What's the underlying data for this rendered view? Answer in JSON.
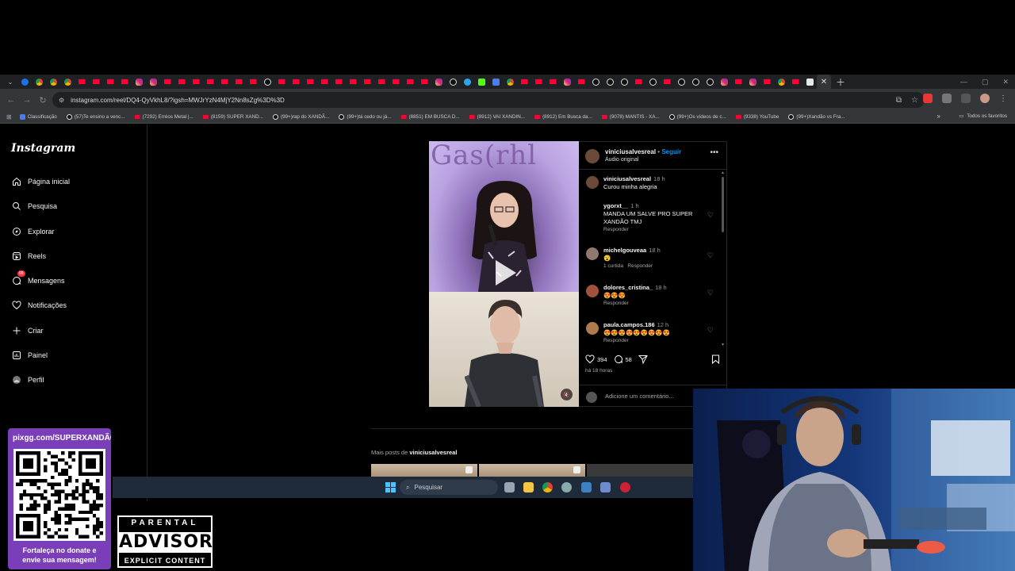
{
  "browser": {
    "url": "instagram.com/reel/DQ4-QyVkhL8/?igsh=MWJrYzN4MjY2Nn8sZg%3D%3D",
    "tab_favicons": [
      "gr",
      "cr",
      "cr",
      "cr",
      "yt",
      "yt",
      "yt",
      "yt",
      "ig",
      "ig",
      "yt",
      "yt",
      "yt",
      "yt",
      "yt",
      "yt",
      "yt",
      "tt",
      "yt",
      "yt",
      "yt",
      "yt",
      "yt",
      "yt",
      "yt",
      "yt",
      "yt",
      "yt",
      "yt",
      "ig",
      "tt",
      "tg",
      "kk",
      "bl",
      "cr",
      "yt",
      "yt",
      "yt",
      "ig",
      "yt",
      "tt",
      "tt",
      "tt",
      "yt",
      "tt",
      "yt",
      "tt",
      "tt",
      "tt",
      "ig",
      "yt",
      "ig",
      "yt",
      "cr",
      "yt",
      "wh"
    ],
    "bookmarks": [
      {
        "icon": "bl",
        "label": "Classificação"
      },
      {
        "icon": "tt",
        "label": "(57)Te ensino a venc..."
      },
      {
        "icon": "yt",
        "label": "(7292) Erréos Metal |..."
      },
      {
        "icon": "yt",
        "label": "(8159) SUPER XAND..."
      },
      {
        "icon": "tt",
        "label": "(99+)rap do XANDÃ..."
      },
      {
        "icon": "tt",
        "label": "(99+)tá cedo ou já..."
      },
      {
        "icon": "yt",
        "label": "(8851) EM BUSCA D..."
      },
      {
        "icon": "yt",
        "label": "(8912) VAI XANDIN..."
      },
      {
        "icon": "yt",
        "label": "(8912) Em Busca da..."
      },
      {
        "icon": "yt",
        "label": "(9078) MANTIS - XA..."
      },
      {
        "icon": "tt",
        "label": "(99+)Os vídeos de c..."
      },
      {
        "icon": "yt",
        "label": "(9338) YouTube"
      },
      {
        "icon": "tt",
        "label": "(99+)Xandão vs Fra..."
      }
    ],
    "bookmarks_all": "Todos os favoritos"
  },
  "instagram": {
    "logo": "Instagram",
    "nav": [
      {
        "name": "home",
        "icon": "home-icon",
        "label": "Página inicial"
      },
      {
        "name": "search",
        "icon": "search-icon",
        "label": "Pesquisa"
      },
      {
        "name": "explore",
        "icon": "compass-icon",
        "label": "Explorar"
      },
      {
        "name": "reels",
        "icon": "reels-icon",
        "label": "Reels"
      },
      {
        "name": "messages",
        "icon": "messenger-icon",
        "label": "Mensagens"
      },
      {
        "name": "notifications",
        "icon": "heart-icon",
        "label": "Notificações"
      },
      {
        "name": "create",
        "icon": "plus-icon",
        "label": "Criar"
      },
      {
        "name": "dashboard",
        "icon": "chart-icon",
        "label": "Painel"
      },
      {
        "name": "profile",
        "icon": "avatar-icon",
        "label": "Perfil"
      }
    ],
    "messages_badge": "99",
    "reel": {
      "overlay_text": "Gas(rhl"
    },
    "post": {
      "username": "viniciusalvesreal",
      "separator": "•",
      "follow": "Seguir",
      "audio": "Áudio original",
      "comments": [
        {
          "user": "viniciusalvesreal",
          "time": "18 h",
          "text": "Curou minha alegria",
          "meta": "",
          "heart": false
        },
        {
          "user": "ygorxt__",
          "time": "1 h",
          "text": "MANDA UM SALVE PRO SUPER XANDÃO TMJ",
          "meta": "Responder",
          "heart": true
        },
        {
          "user": "michelgouveaa",
          "time": "18 h",
          "text": "😮",
          "meta": "1 curtida   Responder",
          "heart": true
        },
        {
          "user": "dolores_cristina_",
          "time": "18 h",
          "text": "😍😍😍",
          "meta": "Responder",
          "heart": true
        },
        {
          "user": "paula.campos.186",
          "time": "12 h",
          "text": "😍😍😍😍😍😍😍😍😍",
          "meta": "Responder",
          "heart": true
        }
      ],
      "likes": "394",
      "comments_count": "58",
      "posted_ago": "há 18 horas",
      "add_comment": "Adicione um comentário..."
    },
    "more_posts_prefix": "Mais posts de",
    "more_posts_user": "viniciusalvesreal"
  },
  "taskbar": {
    "search": "Pesquisar"
  },
  "overlay": {
    "donate_url": "pixgg.com/SUPERXANDÃO",
    "donate_msg_1": "Fortaleça no donate e",
    "donate_msg_2": "envie sua mensagem!",
    "parental_1": "PARENTAL",
    "parental_2": "ADVISORY",
    "parental_3": "EXPLICIT CONTENT"
  }
}
